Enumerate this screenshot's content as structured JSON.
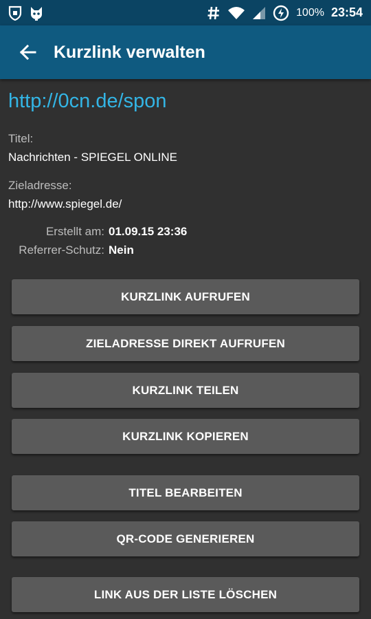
{
  "status_bar": {
    "left_icons": [
      "shield-notification-icon",
      "cat-notification-icon"
    ],
    "right_icons": [
      "hash-icon",
      "wifi-icon",
      "cell-signal-icon",
      "battery-charging-icon"
    ],
    "battery": "100%",
    "time": "23:54"
  },
  "app_bar": {
    "back_icon": "arrow-back-icon",
    "title": "Kurzlink verwalten"
  },
  "link": {
    "short_url": "http://0cn.de/spon",
    "title_label": "Titel:",
    "title_value": "Nachrichten - SPIEGEL ONLINE",
    "target_label": "Zieladresse:",
    "target_value": "http://www.spiegel.de/",
    "created_label": "Erstellt am:",
    "created_value": "01.09.15 23:36",
    "referrer_label": "Referrer-Schutz:",
    "referrer_value": "Nein"
  },
  "buttons": {
    "open_short": "KURZLINK AUFRUFEN",
    "open_target": "ZIELADRESSE DIREKT AUFRUFEN",
    "share": "KURZLINK TEILEN",
    "copy": "KURZLINK KOPIEREN",
    "edit_title": "TITEL BEARBEITEN",
    "qr_code": "QR-CODE GENERIEREN",
    "delete": "LINK AUS DER LISTE LÖSCHEN"
  },
  "colors": {
    "status_bar": "#0b4463",
    "app_bar": "#0f5a80",
    "background": "#303030",
    "link_accent": "#33b5e5",
    "button": "#5a5a5a"
  }
}
